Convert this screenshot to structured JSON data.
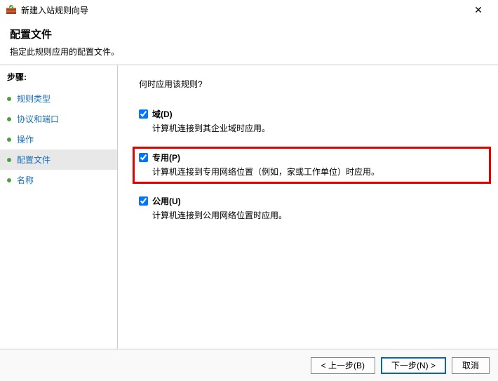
{
  "window": {
    "title": "新建入站规则向导",
    "close": "✕"
  },
  "header": {
    "title": "配置文件",
    "subtitle": "指定此规则应用的配置文件。"
  },
  "sidebar": {
    "steps_label": "步骤:",
    "items": [
      {
        "label": "规则类型"
      },
      {
        "label": "协议和端口"
      },
      {
        "label": "操作"
      },
      {
        "label": "配置文件"
      },
      {
        "label": "名称"
      }
    ]
  },
  "content": {
    "prompt": "何时应用该规则?",
    "options": [
      {
        "label": "域(D)",
        "desc": "计算机连接到其企业域时应用。",
        "checked": true,
        "highlight": false
      },
      {
        "label": "专用(P)",
        "desc": "计算机连接到专用网络位置（例如，家或工作单位）时应用。",
        "checked": true,
        "highlight": true
      },
      {
        "label": "公用(U)",
        "desc": "计算机连接到公用网络位置时应用。",
        "checked": true,
        "highlight": false
      }
    ]
  },
  "footer": {
    "back": "< 上一步(B)",
    "next": "下一步(N) >",
    "cancel": "取消"
  }
}
